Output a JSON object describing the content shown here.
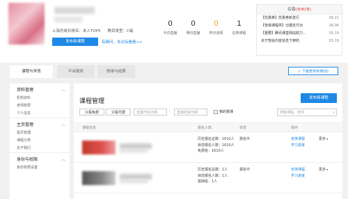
{
  "header": {
    "score_line": [
      "上海总成长排名：未入TOP5",
      "",
      "",
      "教目类型：C级"
    ],
    "publish_button": "发布新课程",
    "help_link": "有疑问，去论坛看看>>",
    "stats": [
      {
        "value": "0",
        "label": "今日直播",
        "highlight": false
      },
      {
        "value": "0",
        "label": "明日直播",
        "highlight": false
      },
      {
        "value": "0",
        "label": "昨日违规",
        "highlight": true
      },
      {
        "value": "1",
        "label": "在架课程",
        "highlight": false
      }
    ]
  },
  "notice": {
    "title": "公告",
    "unread": "(未读1条)",
    "items": [
      {
        "text": "【优惠券】优惠券新发行",
        "date": "06.21"
      },
      {
        "text": "【安缘课程供】分期支付功",
        "date": "06.06"
      },
      {
        "text": "【重要】腾讯课堂网站助力...",
        "date": "05.19"
      },
      {
        "text": "关于暂给内容信息下架的",
        "date": "05.19"
      }
    ]
  },
  "tabs": [
    {
      "label": "课程与学员",
      "active": true
    },
    {
      "label": "平台服务",
      "active": false
    },
    {
      "label": "账单与结算",
      "active": false
    }
  ],
  "download_button": "⇩ 下载老师专用QQ",
  "sidebar": {
    "groups": [
      {
        "title": "资料管理",
        "items": [
          "机构资料",
          "老师权限",
          "个人信息"
        ]
      },
      {
        "title": "主页管理",
        "items": [
          "首页管理",
          "课程分类",
          "关于我们"
        ]
      },
      {
        "title": "身份与权限",
        "items": [
          "身份权限设置"
        ]
      }
    ]
  },
  "main": {
    "title": "课程管理",
    "publish_button": "发布新课程",
    "filter_free": "只看免费",
    "filter_paid": "只看付费",
    "date_start_placeholder": "直播开始日期",
    "date_end_placeholder": "直播结束日期",
    "my_courses_label": "我的报课",
    "search_placeholder": "搜索课程、老师",
    "columns": [
      "课程信息",
      "报名人数",
      "状态",
      "操作"
    ],
    "rows": [
      {
        "metrics": [
          "历史报名总数：1610人",
          "目前报名人数：1610人",
          "免费班：1610人"
        ],
        "status": "报名中",
        "actions": [
          "安排课程",
          "学习进度"
        ],
        "more": "更多"
      },
      {
        "metrics": [
          "历史报名总数：1人",
          "目前报名人数：1人",
          "基础班：1人"
        ],
        "status": "报名中",
        "actions": [
          "安排课程",
          "学习进度"
        ],
        "more": "更多"
      }
    ]
  }
}
